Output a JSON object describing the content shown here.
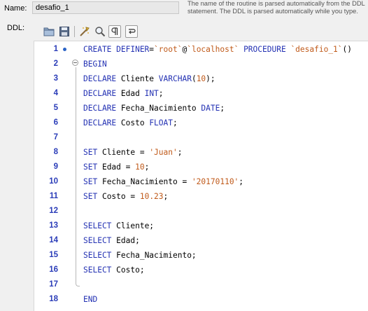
{
  "form": {
    "name_label": "Name:",
    "name_value": "desafio_1",
    "ddl_label": "DDL:",
    "hint_line1": "The name of the routine is parsed automatically from the DDL",
    "hint_line2": "statement. The DDL is parsed automatically while you type."
  },
  "toolbar": {
    "icons": [
      "open-folder-icon",
      "save-icon",
      "beautify-icon",
      "search-icon",
      "paragraph-icon",
      "wrap-icon"
    ]
  },
  "editor": {
    "lines": [
      {
        "n": "1",
        "tokens": [
          [
            "k",
            "CREATE DEFINER"
          ],
          [
            "t",
            "="
          ],
          [
            "s",
            "`root`"
          ],
          [
            "t",
            "@"
          ],
          [
            "s",
            "`localhost`"
          ],
          [
            "t",
            " "
          ],
          [
            "k",
            "PROCEDURE"
          ],
          [
            "t",
            " "
          ],
          [
            "s",
            "`desafio_1`"
          ],
          [
            "t",
            "()"
          ]
        ]
      },
      {
        "n": "2",
        "tokens": [
          [
            "k",
            "BEGIN"
          ]
        ]
      },
      {
        "n": "3",
        "tokens": [
          [
            "k",
            "DECLARE"
          ],
          [
            "t",
            " Cliente "
          ],
          [
            "k",
            "VARCHAR"
          ],
          [
            "t",
            "("
          ],
          [
            "n",
            "10"
          ],
          [
            "t",
            ");"
          ]
        ]
      },
      {
        "n": "4",
        "tokens": [
          [
            "k",
            "DECLARE"
          ],
          [
            "t",
            " Edad "
          ],
          [
            "k",
            "INT"
          ],
          [
            "t",
            ";"
          ]
        ]
      },
      {
        "n": "5",
        "tokens": [
          [
            "k",
            "DECLARE"
          ],
          [
            "t",
            " Fecha_Nacimiento "
          ],
          [
            "k",
            "DATE"
          ],
          [
            "t",
            ";"
          ]
        ]
      },
      {
        "n": "6",
        "tokens": [
          [
            "k",
            "DECLARE"
          ],
          [
            "t",
            " Costo "
          ],
          [
            "k",
            "FLOAT"
          ],
          [
            "t",
            ";"
          ]
        ]
      },
      {
        "n": "7",
        "tokens": []
      },
      {
        "n": "8",
        "tokens": [
          [
            "k",
            "SET"
          ],
          [
            "t",
            " Cliente = "
          ],
          [
            "s",
            "'Juan'"
          ],
          [
            "t",
            ";"
          ]
        ]
      },
      {
        "n": "9",
        "tokens": [
          [
            "k",
            "SET"
          ],
          [
            "t",
            " Edad = "
          ],
          [
            "n",
            "10"
          ],
          [
            "t",
            ";"
          ]
        ]
      },
      {
        "n": "10",
        "tokens": [
          [
            "k",
            "SET"
          ],
          [
            "t",
            " Fecha_Nacimiento = "
          ],
          [
            "s",
            "'20170110'"
          ],
          [
            "t",
            ";"
          ]
        ]
      },
      {
        "n": "11",
        "tokens": [
          [
            "k",
            "SET"
          ],
          [
            "t",
            " Costo = "
          ],
          [
            "n",
            "10.23"
          ],
          [
            "t",
            ";"
          ]
        ]
      },
      {
        "n": "12",
        "tokens": []
      },
      {
        "n": "13",
        "tokens": [
          [
            "k",
            "SELECT"
          ],
          [
            "t",
            " Cliente;"
          ]
        ]
      },
      {
        "n": "14",
        "tokens": [
          [
            "k",
            "SELECT"
          ],
          [
            "t",
            " Edad;"
          ]
        ]
      },
      {
        "n": "15",
        "tokens": [
          [
            "k",
            "SELECT"
          ],
          [
            "t",
            " Fecha_Nacimiento;"
          ]
        ]
      },
      {
        "n": "16",
        "tokens": [
          [
            "k",
            "SELECT"
          ],
          [
            "t",
            " Costo;"
          ]
        ]
      },
      {
        "n": "17",
        "tokens": []
      },
      {
        "n": "18",
        "tokens": [
          [
            "k",
            "END"
          ]
        ]
      }
    ]
  }
}
